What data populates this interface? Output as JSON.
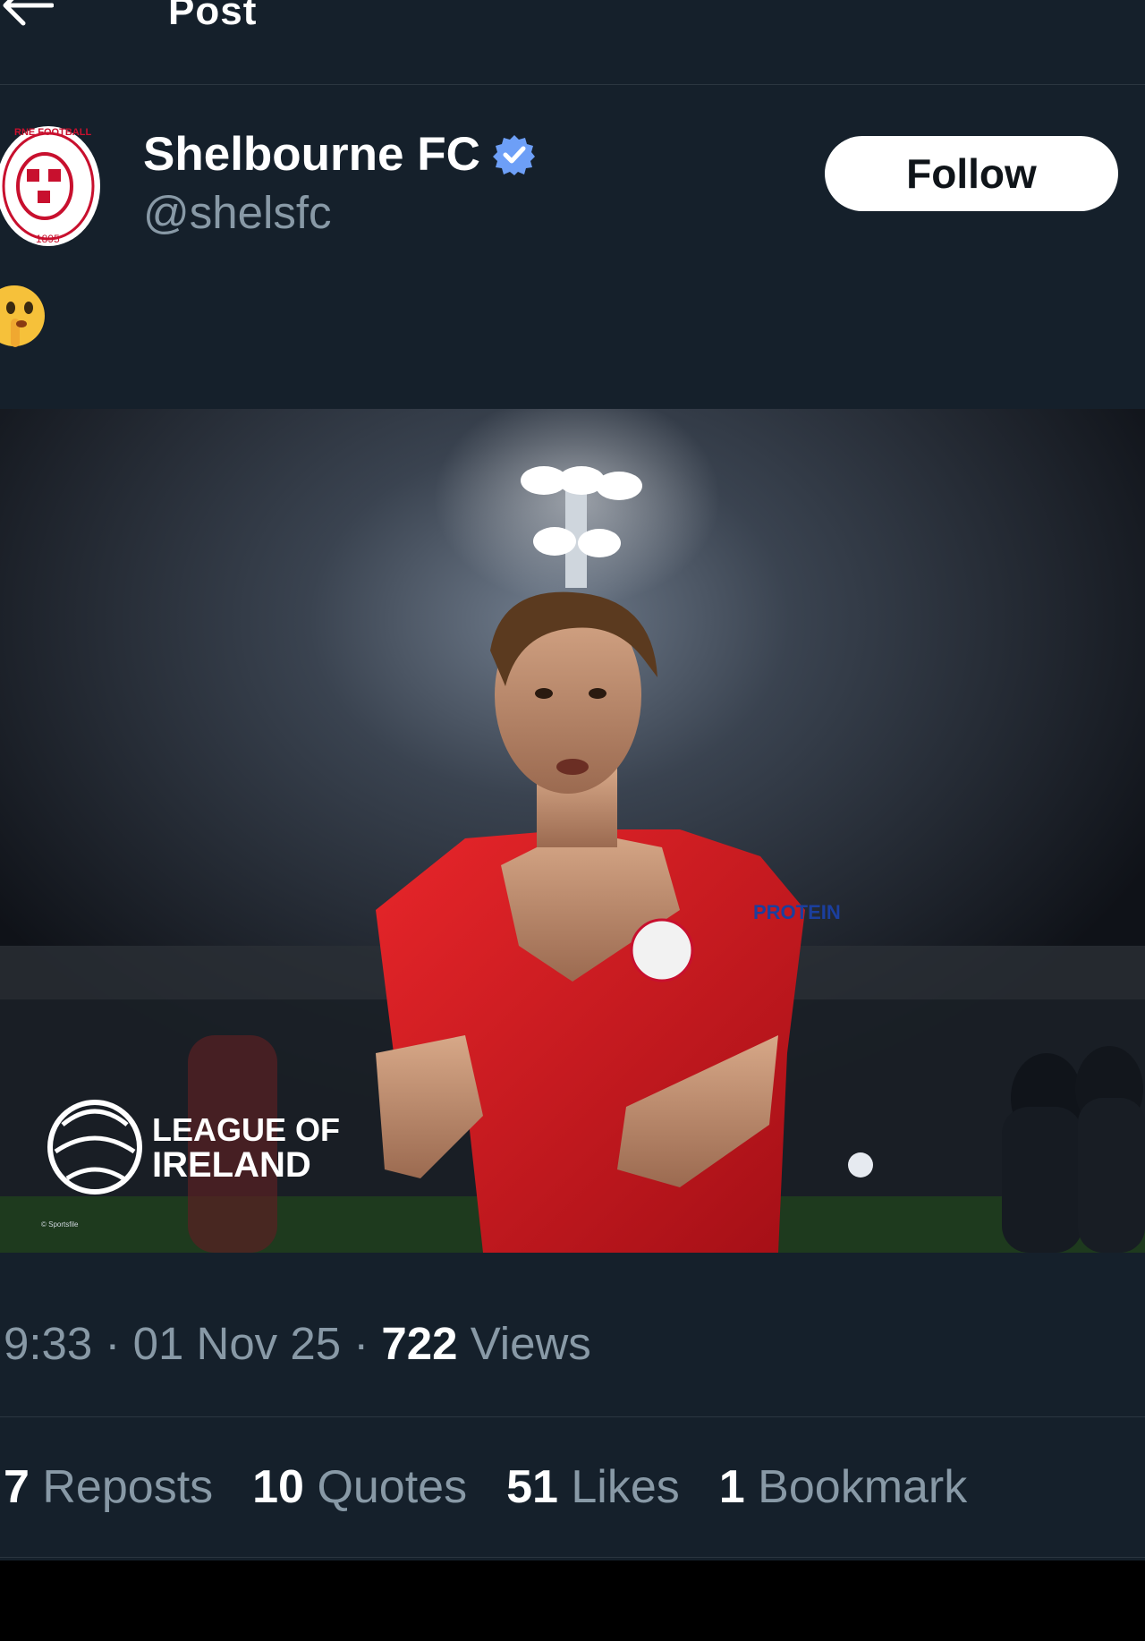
{
  "header": {
    "title": "Post",
    "back_icon": "arrow-left-icon"
  },
  "author": {
    "name": "Shelbourne FC",
    "handle": "@shelsfc",
    "verified_icon": "verified-badge-icon",
    "avatar_icon": "club-crest-icon",
    "avatar_text_top": "SHELBOURNE FOOTBALL CLUB",
    "avatar_year": "1895"
  },
  "follow_label": "Follow",
  "post": {
    "emoji_icon": "shushing-face-emoji"
  },
  "media": {
    "overlay_text": "LEAGUE OF IRELAND",
    "overlay_line1": "LEAGUE OF",
    "overlay_line2": "IRELAND",
    "credit": "© Sportsfile",
    "jersey_text": "PROTEIN MILK"
  },
  "meta": {
    "time": "9:33",
    "sep": " · ",
    "date": "01 Nov 25",
    "views_count": "722",
    "views_label": "Views"
  },
  "stats": [
    {
      "count": "7",
      "label": "Reposts"
    },
    {
      "count": "10",
      "label": "Quotes"
    },
    {
      "count": "51",
      "label": "Likes"
    },
    {
      "count": "1",
      "label": "Bookmark"
    }
  ],
  "colors": {
    "background": "#15202b",
    "muted": "#8899a6",
    "accent": "#1d9bf0",
    "jersey": "#d81e1e"
  }
}
